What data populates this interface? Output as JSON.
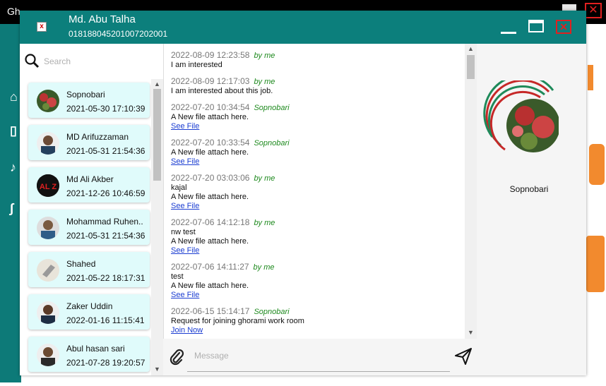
{
  "background_app": {
    "title": "Gh",
    "close_label": "✕"
  },
  "window": {
    "contact_name": "Md. Abu Talha",
    "contact_id": "01818804520100720200​1",
    "close_label": "✕",
    "app_icon_label": "x",
    "colors": {
      "titlebar": "#0c7f7c",
      "contact_bg": "#e0fbfb",
      "link": "#1a3cd1",
      "sender": "#1e8a1e"
    }
  },
  "search": {
    "placeholder": "Search"
  },
  "contacts": [
    {
      "name": "Sopnobari",
      "date": "2021-05-30 17:10:39",
      "avatar": "flowers-photo"
    },
    {
      "name": "MD Arifuzzaman",
      "date": "2021-05-31 21:54:36",
      "avatar": "man-photo"
    },
    {
      "name": "Md Ali Akber",
      "date": "2021-12-26 10:46:59",
      "avatar": "al-z-logo",
      "avatar_text": "AL Z"
    },
    {
      "name": "Mohammad Ruhen..",
      "date": "2021-05-31 21:54:36",
      "avatar": "man-photo"
    },
    {
      "name": "Shahed",
      "date": "2021-05-22 18:17:31",
      "avatar": "laptop-photo"
    },
    {
      "name": "Zaker Uddin",
      "date": "2022-01-16 11:15:41",
      "avatar": "man-photo"
    },
    {
      "name": "Abul hasan sari",
      "date": "2021-07-28 19:20:57",
      "avatar": "man-photo"
    }
  ],
  "messages": [
    {
      "time": "2022-08-09 12:23:58",
      "sender": "by me",
      "lines": [
        "I am interested"
      ],
      "link": ""
    },
    {
      "time": "2022-08-09 12:17:03",
      "sender": "by me",
      "lines": [
        "I am interested about this job."
      ],
      "link": ""
    },
    {
      "time": "2022-07-20 10:34:54",
      "sender": "Sopnobari",
      "lines": [
        "A New file attach here."
      ],
      "link": "See File"
    },
    {
      "time": "2022-07-20 10:33:54",
      "sender": "Sopnobari",
      "lines": [
        "A New file attach here."
      ],
      "link": "See File"
    },
    {
      "time": "2022-07-20 03:03:06",
      "sender": "by me",
      "lines": [
        "kajal",
        "A New file attach here."
      ],
      "link": "See File"
    },
    {
      "time": "2022-07-06 14:12:18",
      "sender": "by me",
      "lines": [
        "nw test",
        "A New file attach here."
      ],
      "link": "See File"
    },
    {
      "time": "2022-07-06 14:11:27",
      "sender": "by me",
      "lines": [
        "test",
        "A New file attach here."
      ],
      "link": "See File"
    },
    {
      "time": "2022-06-15 15:14:17",
      "sender": "Sopnobari",
      "lines": [
        "Request for joining ghorami work room"
      ],
      "link": "Join Now"
    }
  ],
  "composer": {
    "placeholder": "Message"
  },
  "profile": {
    "name": "Sopnobari"
  }
}
